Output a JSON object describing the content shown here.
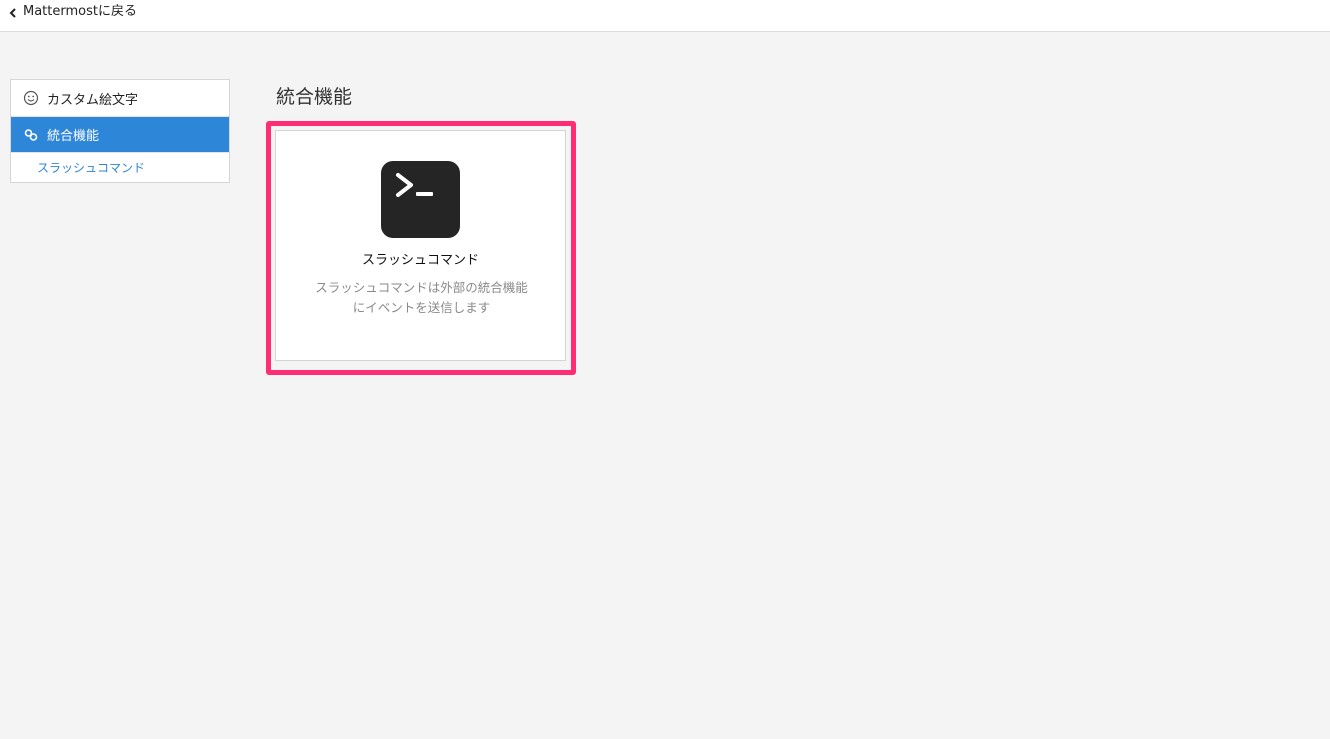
{
  "header": {
    "back_label": "Mattermostに戻る",
    "back_icon": "chevron-left-icon"
  },
  "sidebar": {
    "items": [
      {
        "label": "カスタム絵文字",
        "icon": "smiley-icon",
        "active": false
      },
      {
        "label": "統合機能",
        "icon": "link-icon",
        "active": true
      }
    ],
    "sub_items": [
      {
        "label": "スラッシュコマンド"
      }
    ]
  },
  "main": {
    "title": "統合機能",
    "cards": [
      {
        "icon": "terminal-icon",
        "title": "スラッシュコマンド",
        "desc_line1": "スラッシュコマンドは外部の統合機能",
        "desc_line2": "にイベントを送信します",
        "highlighted": true
      }
    ]
  },
  "colors": {
    "accent": "#2e86d8",
    "highlight": "#ff2d73",
    "background": "#f4f4f4",
    "icon_bg": "#252525"
  }
}
